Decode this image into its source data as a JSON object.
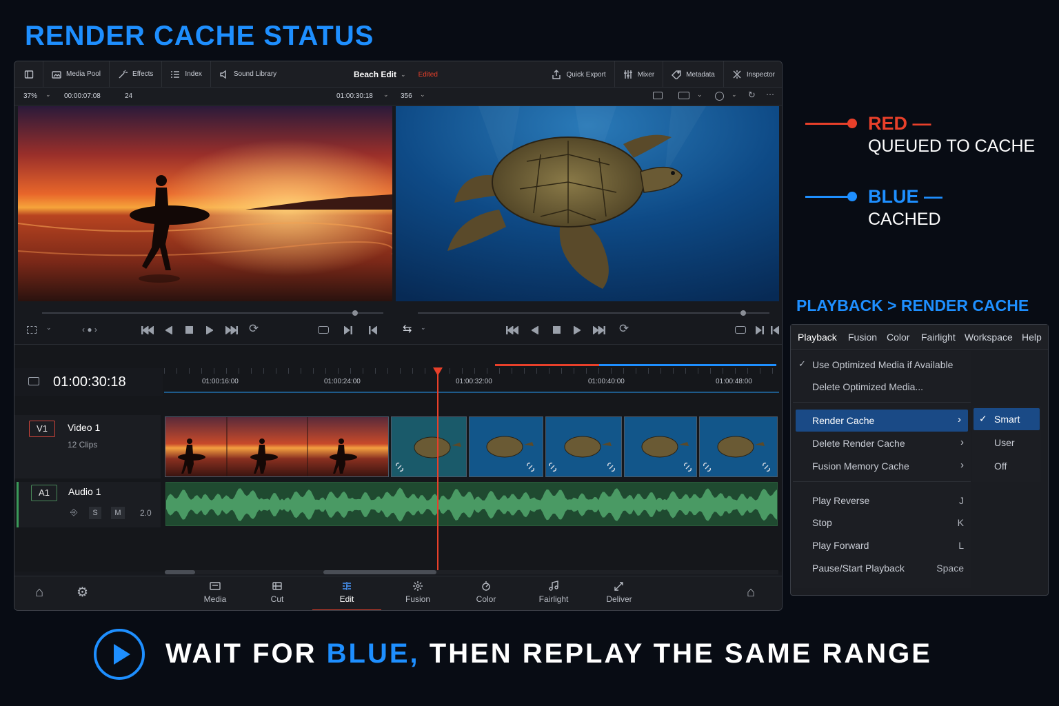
{
  "heading": "RENDER CACHE STATUS",
  "toolbar": {
    "media_pool": "Media Pool",
    "effects": "Effects",
    "index": "Index",
    "sound_library": "Sound Library",
    "project_name": "Beach Edit",
    "project_status": "Edited",
    "quick_export": "Quick Export",
    "mixer": "Mixer",
    "metadata": "Metadata",
    "inspector": "Inspector"
  },
  "viewer_bar": {
    "zoom": "37%",
    "duration": "00:00:07:08",
    "fps": "24",
    "timecode": "01:00:30:18",
    "frame": "356"
  },
  "timeline": {
    "current_timecode": "01:00:30:18",
    "ruler": [
      "01:00:16:00",
      "01:00:24:00",
      "01:00:32:00",
      "01:00:40:00",
      "01:00:48:00"
    ],
    "cache_red_fraction": 0.37,
    "cache_blue_fraction": 0.63
  },
  "tracks": {
    "video": {
      "id": "V1",
      "name": "Video 1",
      "clips": "12 Clips"
    },
    "audio": {
      "id": "A1",
      "name": "Audio 1",
      "solo": "S",
      "mute": "M",
      "level": "2.0"
    }
  },
  "pages": [
    "Media",
    "Cut",
    "Edit",
    "Fusion",
    "Color",
    "Fairlight",
    "Deliver"
  ],
  "active_page": "Edit",
  "legend": {
    "red_title": "RED —",
    "red_desc": "QUEUED TO CACHE",
    "blue_title": "BLUE —",
    "blue_desc": "CACHED",
    "red_color": "#e8402a",
    "blue_color": "#1e8fff"
  },
  "menu_heading": "PLAYBACK > RENDER CACHE",
  "menubar": [
    "Playback",
    "Fusion",
    "Color",
    "Fairlight",
    "Workspace",
    "Help"
  ],
  "menu_items": {
    "optimized": "Use Optimized Media if Available",
    "delete_optimized": "Delete Optimized Media...",
    "render_cache": "Render Cache",
    "delete_render_cache": "Delete Render Cache",
    "fusion_memory": "Fusion Memory Cache",
    "play_reverse": "Play Reverse",
    "play_reverse_key": "J",
    "stop": "Stop",
    "stop_key": "K",
    "play_forward": "Play Forward",
    "play_forward_key": "L",
    "pause_start": "Pause/Start Playback",
    "pause_start_key": "Space"
  },
  "submenu": {
    "smart": "Smart",
    "user": "User",
    "off": "Off",
    "selected": "Smart"
  },
  "footer": {
    "part1": "WAIT FOR ",
    "part2": "BLUE,",
    "part3": " THEN REPLAY THE SAME RANGE"
  }
}
